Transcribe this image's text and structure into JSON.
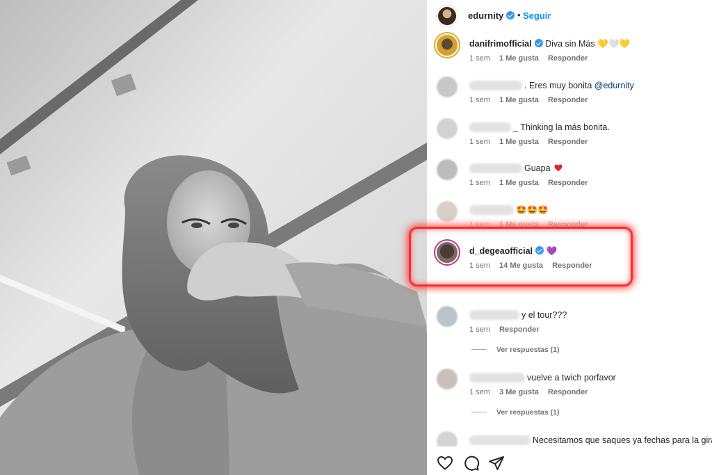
{
  "post_author": {
    "username": "edurnity",
    "follow_label": "Seguir",
    "dot": "•"
  },
  "comments": [
    {
      "username": "danifrimofficial",
      "verified": true,
      "text": "Diva sin Más 💛🤍💛",
      "time": "1 sem",
      "likes": "1 Me gusta",
      "reply": "Responder"
    },
    {
      "username": "",
      "verified": false,
      "text": ". Eres muy bonita ",
      "mention": "@edurnity",
      "time": "1 sem",
      "likes": "1 Me gusta",
      "reply": "Responder"
    },
    {
      "username": "",
      "verified": false,
      "text": "_ Thinking la más bonita.",
      "time": "1 sem",
      "likes": "1 Me gusta",
      "reply": "Responder"
    },
    {
      "username": "",
      "verified": false,
      "text": "Guapa",
      "time": "1 sem",
      "likes": "1 Me gusta",
      "reply": "Responder"
    },
    {
      "username": "",
      "verified": false,
      "text": "🤩🤩🤩",
      "time": "1 sem",
      "likes": "1 Me gusta",
      "reply": "Responder"
    },
    {
      "username": "d_degeaofficial",
      "verified": true,
      "text": "💜",
      "time": "1 sem",
      "likes": "14 Me gusta",
      "reply": "Responder"
    },
    {
      "username": "",
      "verified": false,
      "text": "y el tour???",
      "time": "1 sem",
      "reply": "Responder",
      "view_replies": "Ver respuestas (1)"
    },
    {
      "username": "",
      "verified": false,
      "text": "vuelve a twich porfavor",
      "time": "1 sem",
      "likes": "3 Me gusta",
      "reply": "Responder",
      "view_replies": "Ver respuestas (1)"
    },
    {
      "username": "",
      "verified": false,
      "text": "Necesitamos que saques ya fechas para la gira"
    }
  ],
  "actions": {
    "like_icon": "heart-icon",
    "comment_icon": "comment-icon",
    "share_icon": "send-icon"
  },
  "colors": {
    "verified": "#3897f0",
    "follow": "#0095f6",
    "highlight": "#ff2b2b",
    "mention": "#00376b"
  }
}
